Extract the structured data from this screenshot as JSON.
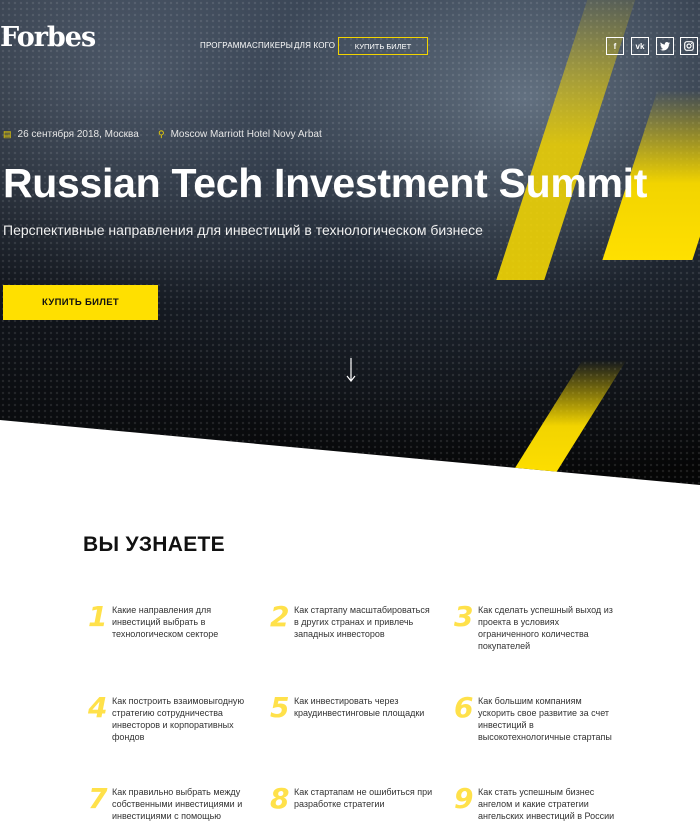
{
  "header": {
    "logo": "Forbes",
    "nav": [
      "ПРОГРАММА",
      "СПИКЕРЫ",
      "ДЛЯ КОГО"
    ],
    "buy_label": "КУПИТЬ БИЛЕТ",
    "social": [
      "facebook-icon",
      "vk-icon",
      "twitter-icon",
      "instagram-icon"
    ]
  },
  "hero": {
    "date": "26 сентября 2018, Москва",
    "venue": "Moscow Marriott Hotel Novy Arbat",
    "title": "Russian Tech Investment Summit",
    "subtitle": "Перспективные направления для инвестиций в технологическом бизнесе",
    "buy_label": "КУПИТЬ БИЛЕТ"
  },
  "learn": {
    "title": "ВЫ УЗНАЕТЕ",
    "items": [
      {
        "num": "1",
        "text": "Какие направления для инвестиций выбрать в технологическом секторе"
      },
      {
        "num": "2",
        "text": "Как стартапу масштабироваться в других странах и привлечь западных инвесторов"
      },
      {
        "num": "3",
        "text": "Как сделать успешный выход из проекта в условиях ограниченного количества покупателей"
      },
      {
        "num": "4",
        "text": "Как построить взаимовыгодную стратегию сотрудничества инвесторов и корпоративных фондов"
      },
      {
        "num": "5",
        "text": "Как инвестировать через краудинвестинговые площадки"
      },
      {
        "num": "6",
        "text": "Как большим компаниям ускорить свое развитие за счет инвестиций в высокотехнологичные стартапы"
      },
      {
        "num": "7",
        "text": "Как правильно выбрать между собственными инвестициями и инвестициями с помощью"
      },
      {
        "num": "8",
        "text": "Как стартапам не ошибиться при разработке стратегии"
      },
      {
        "num": "9",
        "text": "Как стать успешным бизнес ангелом и какие стратегии ангельских инвестиций в России"
      }
    ]
  },
  "colors": {
    "accent": "#ffe000",
    "dark": "#050505",
    "number": "#ffe14a"
  }
}
